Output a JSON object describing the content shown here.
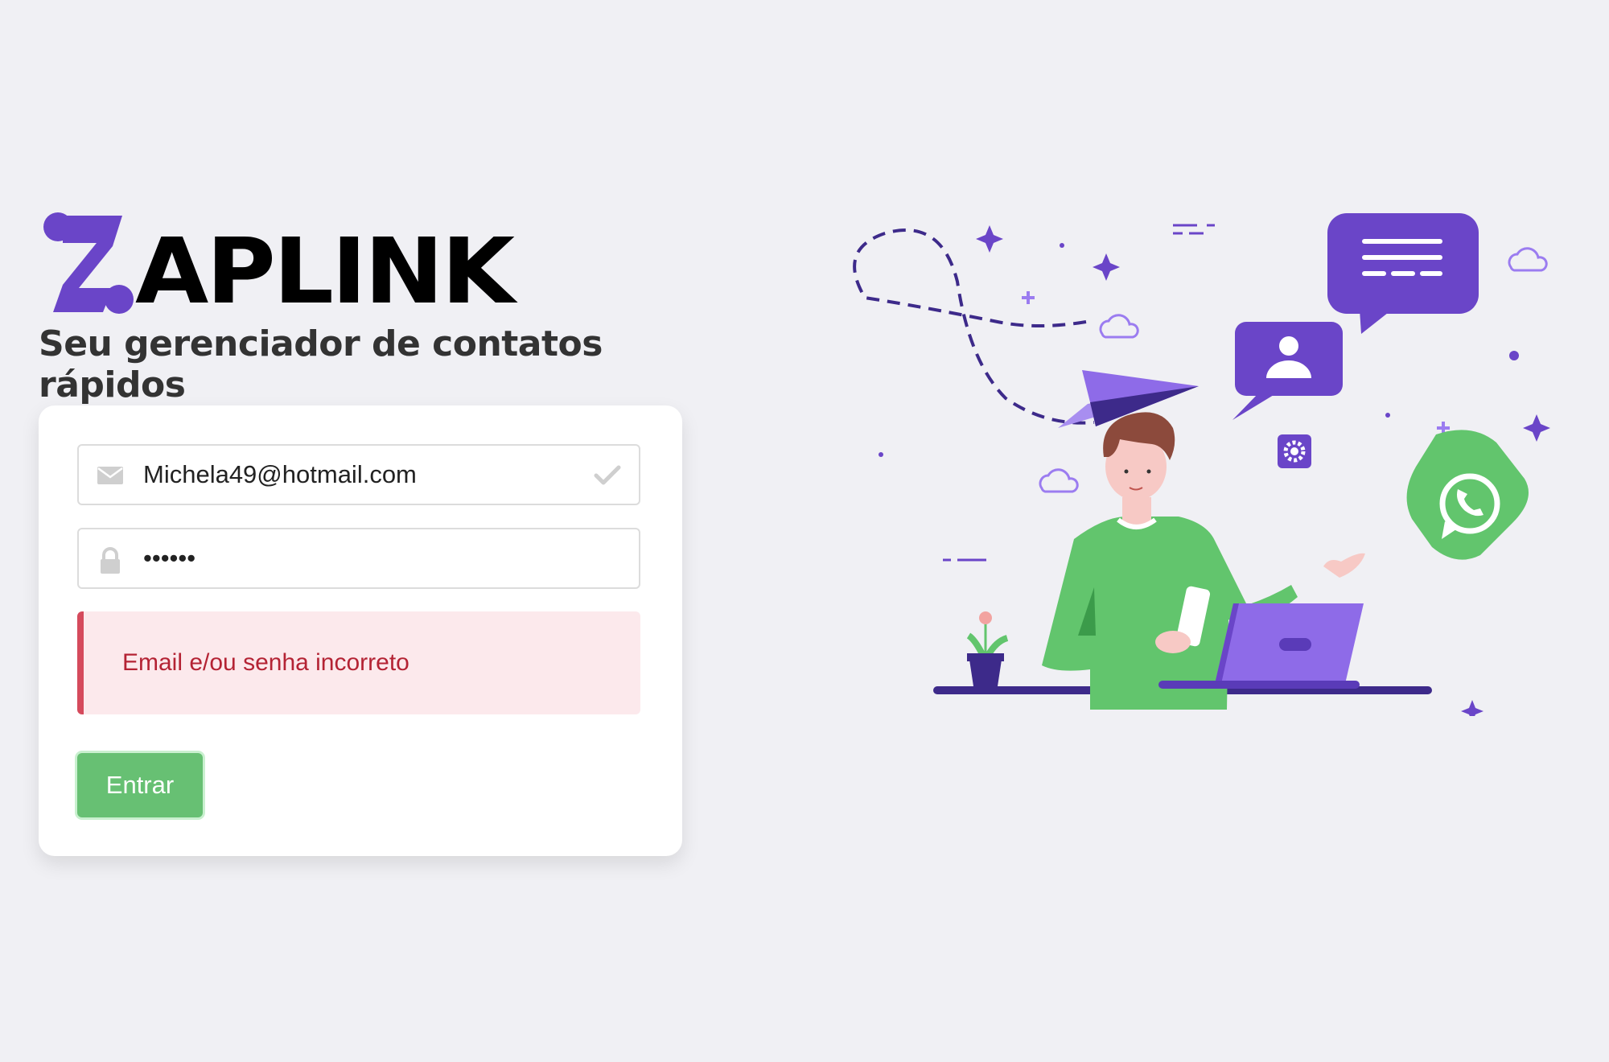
{
  "brand": {
    "logo_letter": "Z",
    "logo_text": "APLINK",
    "tagline": "Seu gerenciador de contatos rápidos",
    "accent_color": "#6a45c8"
  },
  "login": {
    "email_value": "Michela49@hotmail.com",
    "email_icon": "envelope-icon",
    "email_valid_icon": "check-icon",
    "password_value": "••••••",
    "password_icon": "lock-icon",
    "error_message": "Email e/ou senha incorreto",
    "submit_label": "Entrar",
    "submit_color": "#67c073",
    "error_color": "#d54a5c"
  },
  "illustration": {
    "icons": [
      "paper-plane-icon",
      "chat-bubble-icon",
      "contact-bubble-icon",
      "gear-icon",
      "whatsapp-icon",
      "cloud-icon",
      "sparkle-icon",
      "laptop-icon",
      "phone-icon",
      "plant-icon"
    ]
  }
}
